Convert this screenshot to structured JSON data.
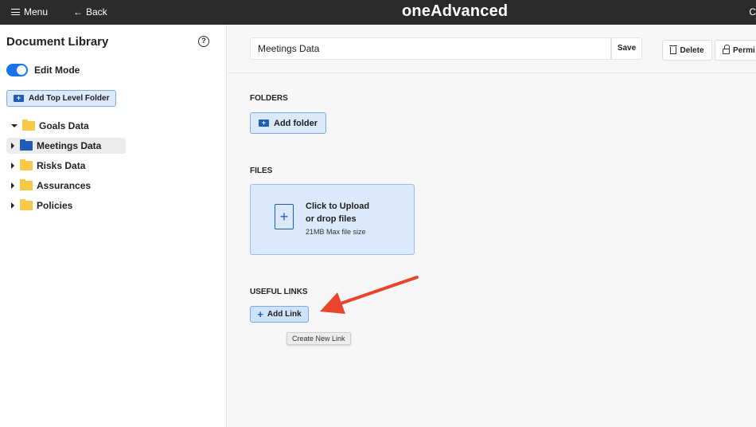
{
  "topbar": {
    "menu_label": "Menu",
    "back_label": "Back",
    "brand": "oneAdvanced",
    "edge_text": "C"
  },
  "sidebar": {
    "title": "Document Library",
    "edit_mode_label": "Edit Mode",
    "edit_mode_on": true,
    "add_top_folder_label": "Add Top Level Folder",
    "items": [
      {
        "label": "Goals Data",
        "expanded": true,
        "selected": false
      },
      {
        "label": "Meetings Data",
        "expanded": false,
        "selected": true
      },
      {
        "label": "Risks Data",
        "expanded": false,
        "selected": false
      },
      {
        "label": "Assurances",
        "expanded": false,
        "selected": false
      },
      {
        "label": "Policies",
        "expanded": false,
        "selected": false
      }
    ]
  },
  "main": {
    "name_value": "Meetings Data",
    "save_label": "Save",
    "delete_label": "Delete",
    "permissions_label": "Permi",
    "folders_heading": "FOLDERS",
    "add_folder_label": "Add folder",
    "files_heading": "FILES",
    "upload_line1": "Click to Upload",
    "upload_line2": "or drop files",
    "upload_limit": "21MB Max file size",
    "links_heading": "USEFUL LINKS",
    "add_link_label": "Add Link",
    "tooltip": "Create New Link"
  },
  "colors": {
    "accent": "#1a73e8",
    "topbar": "#2b2b2b",
    "folder": "#f7c948",
    "annotation_arrow": "#e8442e"
  }
}
